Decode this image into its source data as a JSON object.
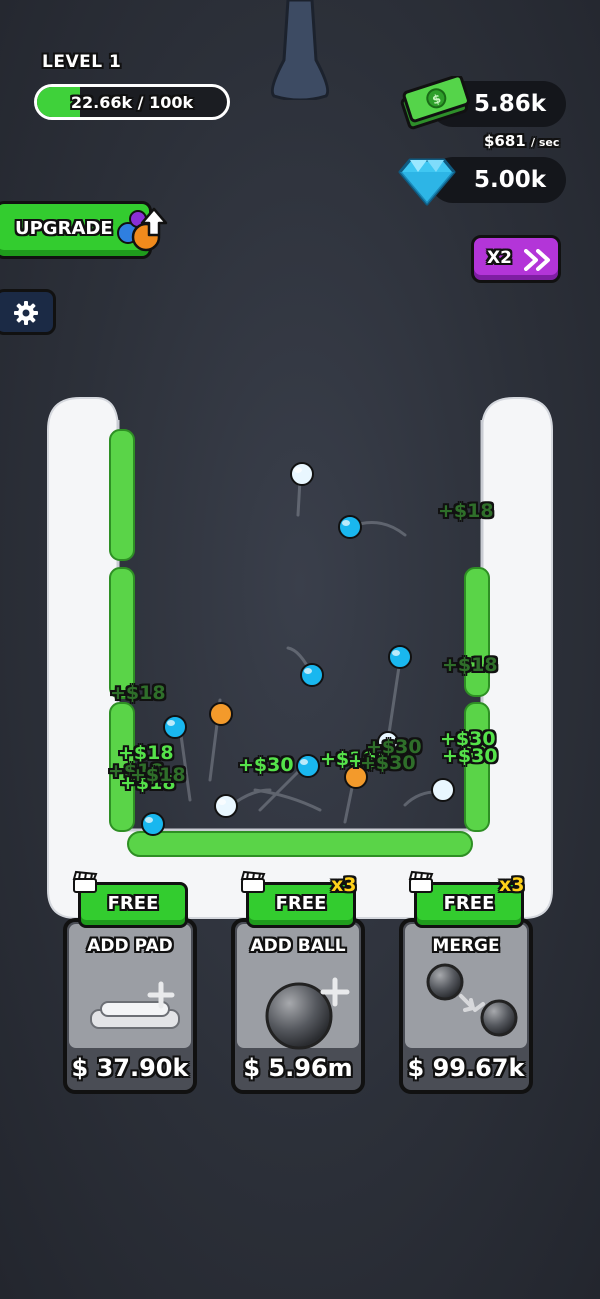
{
  "level": {
    "label": "LEVEL 1",
    "progress_text": "22.66k / 100k",
    "progress_fraction": 0.2266
  },
  "currency": {
    "cash": "5.86k",
    "rate_value": "$681",
    "rate_unit": "/ sec",
    "gems": "5.00k"
  },
  "buttons": {
    "upgrade_label": "UPGRADE",
    "x2_label": "X2"
  },
  "popups": [
    "+$18",
    "+$18",
    "+$18",
    "+$18",
    "+$18",
    "+$18",
    "+$18",
    "+$30",
    "+$10",
    "+$30",
    "+$30",
    "+$30",
    "+$30",
    "+$30"
  ],
  "shop": [
    {
      "tag": "FREE",
      "title": "ADD PAD",
      "price": "$ 37.90k",
      "multiplier": ""
    },
    {
      "tag": "FREE",
      "title": "ADD BALL",
      "price": "$ 5.96m",
      "multiplier": "x3"
    },
    {
      "tag": "FREE",
      "title": "MERGE",
      "price": "$ 99.67k",
      "multiplier": "x3"
    }
  ],
  "colors": {
    "accent_green": "#33cc2f",
    "purple": "#b335d8",
    "ball_blue": "#19b7ef",
    "ball_orange": "#f39a2b"
  }
}
